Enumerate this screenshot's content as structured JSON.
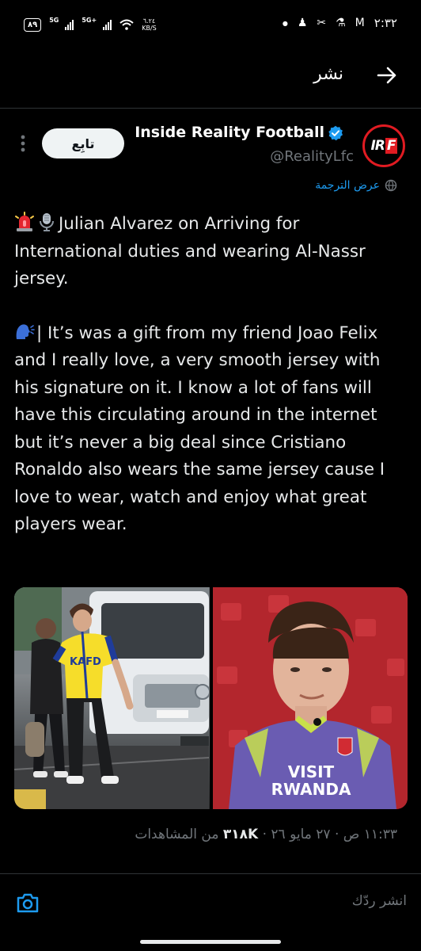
{
  "status_bar": {
    "battery": "٨٩",
    "net1": "5G",
    "net2": "5G+",
    "speed_value": "٦.٢٤",
    "speed_unit": "KB/S",
    "time": "٢:٣٢"
  },
  "header": {
    "title": "نشر"
  },
  "author": {
    "avatar_text": "IRF",
    "name": "Inside Reality Football",
    "handle": "@RealityLfc",
    "follow_label": "تابِع"
  },
  "translate_label": "عرض الترجمة",
  "tweet": {
    "para1": "Julian Alvarez on Arriving for International duties and wearing Al-Nassr jersey.",
    "para2": "| It’s was a gift from my friend Joao Felix and I really love, a very smooth jersey with his signature on it. I know a lot of fans will have this circulating around in the internet but it’s never a big deal since Cristiano Ronaldo also wears the same jersey cause I love to wear, watch and enjoy what great players wear."
  },
  "media": {
    "left_shirt_text": "KAFD",
    "right_shirt_line1": "VISIT",
    "right_shirt_line2": "RWANDA"
  },
  "meta": {
    "time_date": "١١:٣٣ ص · ٢٧ مايو ٢٦ ·",
    "views_count": "٣١٨K",
    "views_label": "من المشاهدات"
  },
  "reply": {
    "placeholder": "انشر ردّك"
  },
  "colors": {
    "accent": "#1d9bf0",
    "background": "#000000",
    "muted": "#71767b",
    "brand_red": "#e11b22"
  },
  "icons": [
    "back-arrow-icon",
    "verified-badge-icon",
    "more-options-icon",
    "translate-icon",
    "camera-icon",
    "siren-emoji",
    "microphone-emoji",
    "speaking-head-emoji"
  ]
}
